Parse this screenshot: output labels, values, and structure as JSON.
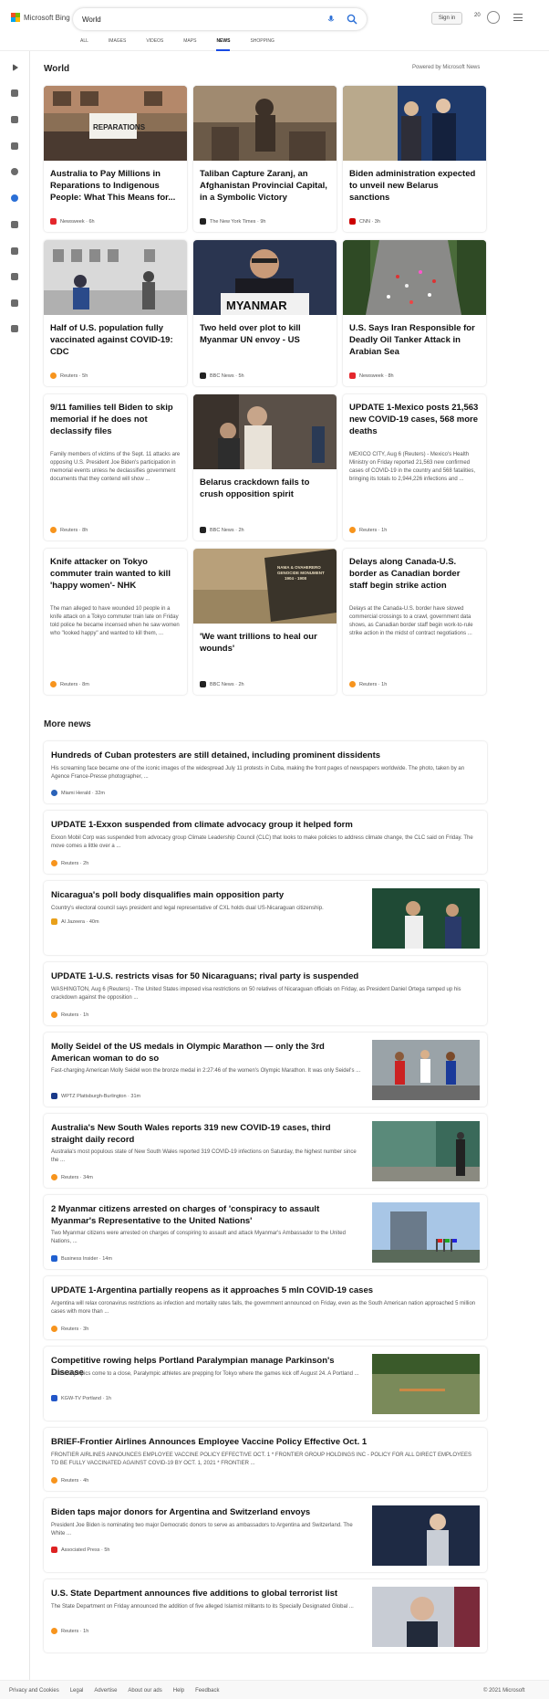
{
  "header": {
    "brand": "Microsoft Bing",
    "search_query": "World",
    "signin_label": "Sign in",
    "rewards_count": "20",
    "tabs": [
      "ALL",
      "IMAGES",
      "VIDEOS",
      "MAPS",
      "NEWS",
      "SHOPPING"
    ],
    "active_tab": "NEWS"
  },
  "main": {
    "section_title": "World",
    "powered_by": "Powered by Microsoft News",
    "cards": [
      {
        "title": "Australia to Pay Millions in Reparations to Indigenous People: What This Means for...",
        "source": "Newsweek · 6h",
        "summary": ""
      },
      {
        "title": "Taliban Capture Zaranj, an Afghanistan Provincial Capital, in a Symbolic Victory",
        "source": "The New York Times · 9h",
        "summary": ""
      },
      {
        "title": "Biden administration expected to unveil new Belarus sanctions",
        "source": "CNN · 3h",
        "summary": ""
      },
      {
        "title": "Half of U.S. population fully vaccinated against COVID-19: CDC",
        "source": "Reuters · 5h",
        "summary": ""
      },
      {
        "title": "Two held over plot to kill Myanmar UN envoy - US",
        "source": "BBC News · 5h",
        "summary": ""
      },
      {
        "title": "U.S. Says Iran Responsible for Deadly Oil Tanker Attack in Arabian Sea",
        "source": "Newsweek · 8h",
        "summary": ""
      },
      {
        "title": "9/11 families tell Biden to skip memorial if he does not declassify files",
        "source": "Reuters · 8h",
        "summary": "Family members of victims of the Sept. 11 attacks are opposing U.S. President Joe Biden's participation in memorial events unless he declassifies government documents that they contend will show ..."
      },
      {
        "title": "Belarus crackdown fails to crush opposition spirit",
        "source": "BBC News · 2h",
        "summary": ""
      },
      {
        "title": "UPDATE 1-Mexico posts 21,563 new COVID-19 cases, 568 more deaths",
        "source": "Reuters · 1h",
        "summary": "MEXICO CITY, Aug 6 (Reuters) - Mexico's Health Ministry on Friday reported 21,563 new confirmed cases of COVID-19 in the country and 568 fatalities, bringing its totals to 2,944,226 infections and ..."
      },
      {
        "title": "Knife attacker on Tokyo commuter train wanted to kill 'happy women'- NHK",
        "source": "Reuters · 8m",
        "summary": "The man alleged to have wounded 10 people in a knife attack on a Tokyo commuter train late on Friday told police he became incensed when he saw women who \"looked happy\" and wanted to kill them, ..."
      },
      {
        "title": "'We want trillions to heal our wounds'",
        "source": "BBC News · 2h",
        "summary": ""
      },
      {
        "title": "Delays along Canada-U.S. border as Canadian border staff begin strike action",
        "source": "Reuters · 1h",
        "summary": "Delays at the Canada-U.S. border have slowed commercial crossings to a crawl, government data shows, as Canadian border staff begin work-to-rule strike action in the midst of contract negotiations ..."
      }
    ],
    "image_texts": {
      "placard": "REPARATIONS",
      "myanmar": "MYANMAR",
      "monument": "NAMA & OVAHERERO GENOCIDE MONUMENT 1904 - 1908"
    }
  },
  "more": {
    "title": "More news",
    "items": [
      {
        "title": "Hundreds of Cuban protesters are still detained, including prominent dissidents",
        "summary": "His screaming face became one of the iconic images of the widespread July 11 protests in Cuba, making the front pages of newspapers worldwide. The photo, taken by an Agence France-Presse photographer, ...",
        "source": "Miami Herald · 32m"
      },
      {
        "title": "UPDATE 1-Exxon suspended from climate advocacy group it helped form",
        "summary": "Exxon Mobil Corp was suspended from advocacy group Climate Leadership Council (CLC) that looks to make policies to address climate change, the CLC said on Friday. The move comes a little over a ...",
        "source": "Reuters · 2h"
      },
      {
        "title": "Nicaragua's poll body disqualifies main opposition party",
        "summary": "Country's electoral council says president and legal representative of CXL holds dual US-Nicaraguan citizenship.",
        "source": "Al Jazeera · 40m"
      },
      {
        "title": "UPDATE 1-U.S. restricts visas for 50 Nicaraguans; rival party is suspended",
        "summary": "WASHINGTON, Aug 6 (Reuters) - The United States imposed visa restrictions on 50 relatives of Nicaraguan officials on Friday, as President Daniel Ortega ramped up his crackdown against the opposition ...",
        "source": "Reuters · 1h"
      },
      {
        "title": "Molly Seidel of the US medals in Olympic Marathon — only the 3rd American woman to do so",
        "summary": "Fast-charging American Molly Seidel won the bronze medal in 2:27:46 of the women's Olympic Marathon. It was only Seidel's ...",
        "source": "WPTZ Plattsburgh-Burlington · 31m"
      },
      {
        "title": "Australia's New South Wales reports 319 new COVID-19 cases, third straight daily record",
        "summary": "Australia's most populous state of New South Wales reported 319 COVID-19 infections on Saturday, the highest number since the ...",
        "source": "Reuters · 34m"
      },
      {
        "title": "2 Myanmar citizens arrested on charges of 'conspiracy to assault Myanmar's Representative to the United Nations'",
        "summary": "Two Myanmar citizens were arrested on charges of conspiring to assault and attack Myanmar's Ambassador to the United Nations, ...",
        "source": "Business Insider · 14m"
      },
      {
        "title": "UPDATE 1-Argentina partially reopens as it approaches 5 mln COVID-19 cases",
        "summary": "Argentina will relax coronavirus restrictions as infection and mortality rates falls, the government announced on Friday, even as the South American nation approached 5 million cases with more than ...",
        "source": "Reuters · 3h"
      },
      {
        "title": "Competitive rowing helps Portland Paralympian manage Parkinson's Disease",
        "summary": "As the Olympics come to a close, Paralympic athletes are prepping for Tokyo where the games kick off August 24. A Portland ...",
        "source": "KGW-TV Portland · 1h"
      },
      {
        "title": "BRIEF-Frontier Airlines Announces Employee Vaccine Policy Effective Oct. 1",
        "summary": "FRONTIER AIRLINES ANNOUNCES EMPLOYEE VACCINE POLICY EFFECTIVE OCT. 1 * FRONTIER GROUP HOLDINGS INC - POLICY FOR ALL DIRECT EMPLOYEES TO BE FULLY VACCINATED AGAINST COVID-19 BY OCT. 1, 2021 * FRONTIER ...",
        "source": "Reuters · 4h"
      },
      {
        "title": "Biden taps major donors for Argentina and Switzerland envoys",
        "summary": "President Joe Biden is nominating two major Democratic donors to serve as ambassadors to Argentina and Switzerland. The White ...",
        "source": "Associated Press · 5h"
      },
      {
        "title": "U.S. State Department announces five additions to global terrorist list",
        "summary": "The State Department on Friday announced the addition of five alleged Islamist militants to its Specially Designated Global ...",
        "source": "Reuters · 1h"
      }
    ]
  },
  "footer": {
    "links": [
      "Privacy and Cookies",
      "Legal",
      "Advertise",
      "About our ads",
      "Help",
      "Feedback"
    ],
    "copyright": "© 2021 Microsoft"
  },
  "colors": {
    "accent": "#174ae4",
    "reuters": "#f7941d",
    "newsweek": "#e4262c",
    "cnn": "#cc0000"
  }
}
